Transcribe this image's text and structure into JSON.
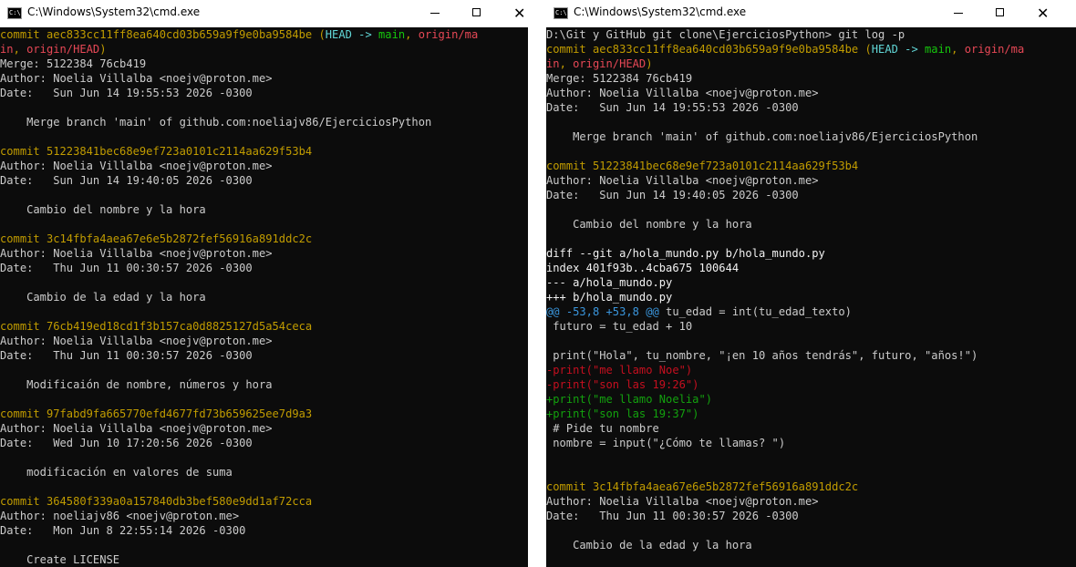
{
  "windows": [
    {
      "id": "left",
      "title": "C:\\Windows\\System32\\cmd.exe",
      "buttons": {
        "minimize": "minimize",
        "maximize": "maximize",
        "close": "close"
      },
      "lines": [
        [
          [
            "y",
            "commit aec833cc11ff8ea640cd03b659a9f9e0ba9584be "
          ],
          [
            "y",
            "("
          ],
          [
            "bc",
            "HEAD -> "
          ],
          [
            "bg",
            "main"
          ],
          [
            "y",
            ", "
          ],
          [
            "br",
            "origin/ma"
          ]
        ],
        [
          [
            "br",
            "in"
          ],
          [
            "y",
            ", "
          ],
          [
            "br",
            "origin/HEAD"
          ],
          [
            "y",
            ")"
          ]
        ],
        [
          [
            "w",
            "Merge: 5122384 76cb419"
          ]
        ],
        [
          [
            "w",
            "Author: Noelia Villalba <noejv@proton.me>"
          ]
        ],
        [
          [
            "w",
            "Date:   Sun Jun 14 19:55:53 2026 -0300"
          ]
        ],
        [
          [
            "w",
            ""
          ]
        ],
        [
          [
            "w",
            "    Merge branch 'main' of github.com:noeliajv86/EjerciciosPython"
          ]
        ],
        [
          [
            "w",
            ""
          ]
        ],
        [
          [
            "y",
            "commit 51223841bec68e9ef723a0101c2114aa629f53b4"
          ]
        ],
        [
          [
            "w",
            "Author: Noelia Villalba <noejv@proton.me>"
          ]
        ],
        [
          [
            "w",
            "Date:   Sun Jun 14 19:40:05 2026 -0300"
          ]
        ],
        [
          [
            "w",
            ""
          ]
        ],
        [
          [
            "w",
            "    Cambio del nombre y la hora"
          ]
        ],
        [
          [
            "w",
            ""
          ]
        ],
        [
          [
            "y",
            "commit 3c14fbfa4aea67e6e5b2872fef56916a891ddc2c"
          ]
        ],
        [
          [
            "w",
            "Author: Noelia Villalba <noejv@proton.me>"
          ]
        ],
        [
          [
            "w",
            "Date:   Thu Jun 11 00:30:57 2026 -0300"
          ]
        ],
        [
          [
            "w",
            ""
          ]
        ],
        [
          [
            "w",
            "    Cambio de la edad y la hora"
          ]
        ],
        [
          [
            "w",
            ""
          ]
        ],
        [
          [
            "y",
            "commit 76cb419ed18cd1f3b157ca0d8825127d5a54ceca"
          ]
        ],
        [
          [
            "w",
            "Author: Noelia Villalba <noejv@proton.me>"
          ]
        ],
        [
          [
            "w",
            "Date:   Thu Jun 11 00:30:57 2026 -0300"
          ]
        ],
        [
          [
            "w",
            ""
          ]
        ],
        [
          [
            "w",
            "    Modificaión de nombre, números y hora"
          ]
        ],
        [
          [
            "w",
            ""
          ]
        ],
        [
          [
            "y",
            "commit 97fabd9fa665770efd4677fd73b659625ee7d9a3"
          ]
        ],
        [
          [
            "w",
            "Author: Noelia Villalba <noejv@proton.me>"
          ]
        ],
        [
          [
            "w",
            "Date:   Wed Jun 10 17:20:56 2026 -0300"
          ]
        ],
        [
          [
            "w",
            ""
          ]
        ],
        [
          [
            "w",
            "    modificación en valores de suma"
          ]
        ],
        [
          [
            "w",
            ""
          ]
        ],
        [
          [
            "y",
            "commit 364580f339a0a157840db3bef580e9dd1af72cca"
          ]
        ],
        [
          [
            "w",
            "Author: noeliajv86 <noejv@proton.me>"
          ]
        ],
        [
          [
            "w",
            "Date:   Mon Jun 8 22:55:14 2026 -0300"
          ]
        ],
        [
          [
            "w",
            ""
          ]
        ],
        [
          [
            "w",
            "    Create LICENSE"
          ]
        ]
      ]
    },
    {
      "id": "right",
      "title": "C:\\Windows\\System32\\cmd.exe",
      "buttons": {
        "minimize": "minimize",
        "maximize": "maximize",
        "close": "close"
      },
      "lines": [
        [
          [
            "w",
            "D:\\Git y GitHub git clone\\EjerciciosPython> git log -p"
          ]
        ],
        [
          [
            "y",
            "commit aec833cc11ff8ea640cd03b659a9f9e0ba9584be "
          ],
          [
            "y",
            "("
          ],
          [
            "bc",
            "HEAD -> "
          ],
          [
            "bg",
            "main"
          ],
          [
            "y",
            ", "
          ],
          [
            "br",
            "origin/ma"
          ]
        ],
        [
          [
            "br",
            "in"
          ],
          [
            "y",
            ", "
          ],
          [
            "br",
            "origin/HEAD"
          ],
          [
            "y",
            ")"
          ]
        ],
        [
          [
            "w",
            "Merge: 5122384 76cb419"
          ]
        ],
        [
          [
            "w",
            "Author: Noelia Villalba <noejv@proton.me>"
          ]
        ],
        [
          [
            "w",
            "Date:   Sun Jun 14 19:55:53 2026 -0300"
          ]
        ],
        [
          [
            "w",
            ""
          ]
        ],
        [
          [
            "w",
            "    Merge branch 'main' of github.com:noeliajv86/EjerciciosPython"
          ]
        ],
        [
          [
            "w",
            ""
          ]
        ],
        [
          [
            "y",
            "commit 51223841bec68e9ef723a0101c2114aa629f53b4"
          ]
        ],
        [
          [
            "w",
            "Author: Noelia Villalba <noejv@proton.me>"
          ]
        ],
        [
          [
            "w",
            "Date:   Sun Jun 14 19:40:05 2026 -0300"
          ]
        ],
        [
          [
            "w",
            ""
          ]
        ],
        [
          [
            "w",
            "    Cambio del nombre y la hora"
          ]
        ],
        [
          [
            "w",
            ""
          ]
        ],
        [
          [
            "bw",
            "diff --git a/hola_mundo.py b/hola_mundo.py"
          ]
        ],
        [
          [
            "bw",
            "index 401f93b..4cba675 100644"
          ]
        ],
        [
          [
            "bw",
            "--- a/hola_mundo.py"
          ]
        ],
        [
          [
            "bw",
            "+++ b/hola_mundo.py"
          ]
        ],
        [
          [
            "cy",
            "@@ -53,8 +53,8 @@"
          ],
          [
            "w",
            " tu_edad = int(tu_edad_texto)"
          ]
        ],
        [
          [
            "w",
            " futuro = tu_edad + 10"
          ]
        ],
        [
          [
            "w",
            ""
          ]
        ],
        [
          [
            "w",
            " print(\"Hola\", tu_nombre, \"¡en 10 años tendrás\", futuro, \"años!\")"
          ]
        ],
        [
          [
            "rd",
            "-print(\"me llamo Noe\")"
          ]
        ],
        [
          [
            "rd",
            "-print(\"son las 19:26\")"
          ]
        ],
        [
          [
            "gr",
            "+print(\"me llamo Noelia\")"
          ]
        ],
        [
          [
            "gr",
            "+print(\"son las 19:37\")"
          ]
        ],
        [
          [
            "w",
            " # Pide tu nombre"
          ]
        ],
        [
          [
            "w",
            " nombre = input(\"¿Cómo te llamas? \")"
          ]
        ],
        [
          [
            "w",
            ""
          ]
        ],
        [
          [
            "w",
            ""
          ]
        ],
        [
          [
            "y",
            "commit 3c14fbfa4aea67e6e5b2872fef56916a891ddc2c"
          ]
        ],
        [
          [
            "w",
            "Author: Noelia Villalba <noejv@proton.me>"
          ]
        ],
        [
          [
            "w",
            "Date:   Thu Jun 11 00:30:57 2026 -0300"
          ]
        ],
        [
          [
            "w",
            ""
          ]
        ],
        [
          [
            "w",
            "    Cambio de la edad y la hora"
          ]
        ]
      ]
    }
  ],
  "colors": {
    "background": "#0c0c0c",
    "text": "#cccccc",
    "commit": "#c19c00",
    "head": "#61d6d6",
    "branch": "#16c60c",
    "remote": "#e74856",
    "hunk": "#3a96dd",
    "removed": "#c50f1f",
    "added": "#13a10e"
  }
}
